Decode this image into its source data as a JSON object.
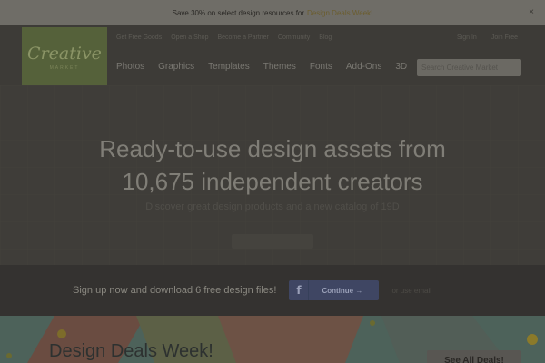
{
  "promo": {
    "text": "Save 30% on select design resources for",
    "link": "Design Deals Week!",
    "close": "×"
  },
  "logo": {
    "main": "Creative",
    "sub": "MARKET"
  },
  "util_nav": [
    "Get Free Goods",
    "Open a Shop",
    "Become a Partner",
    "Community",
    "Blog"
  ],
  "util_right": [
    "Sign In",
    "Join Free"
  ],
  "main_nav": [
    "Photos",
    "Graphics",
    "Templates",
    "Themes",
    "Fonts",
    "Add-Ons",
    "3D"
  ],
  "search": {
    "placeholder": "Search Creative Market"
  },
  "hero": {
    "title_line1": "Ready-to-use design assets from",
    "title_line2": "10,675 independent creators",
    "subtitle": "Discover great design products and a new catalog of 19D"
  },
  "signup": {
    "text": "Sign up now and download 6 free design files!",
    "fb_icon": "f",
    "button": "Continue →",
    "email_link": "or use email"
  },
  "deals": {
    "title": "Design Deals Week!",
    "button": "See All Deals!"
  },
  "colors": {
    "logo_green": "#8ba53f",
    "facebook_blue": "#3b5998",
    "overlay": "#000000"
  }
}
